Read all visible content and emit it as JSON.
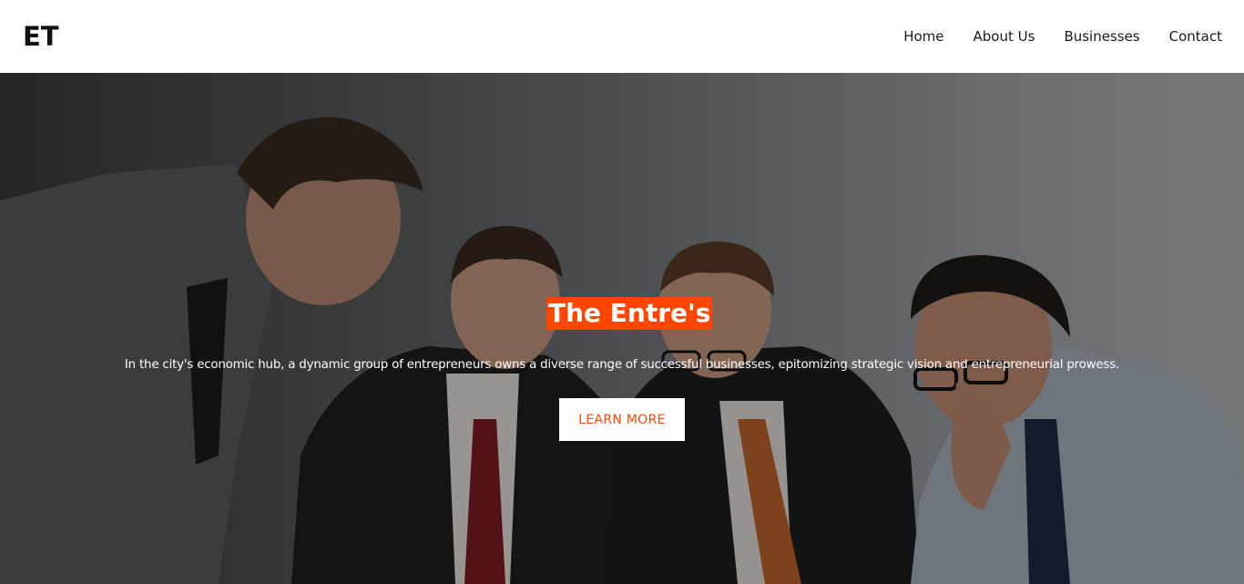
{
  "header": {
    "logo": "ET",
    "nav": [
      {
        "label": "Home"
      },
      {
        "label": "About Us"
      },
      {
        "label": "Businesses"
      },
      {
        "label": "Contact"
      }
    ]
  },
  "hero": {
    "title": "The Entre's",
    "text": "In the city's economic hub, a dynamic group of entrepreneurs owns a diverse range of successful businesses, epitomizing strategic vision and entrepreneurial prowess.",
    "button_label": "LEARN MORE",
    "image_subject": "four businessmen in suits gathered around a table"
  },
  "colors": {
    "accent": "#ff4500",
    "nav_background": "#ffffff",
    "text_dark": "#111111",
    "hero_text": "#ffffff"
  }
}
